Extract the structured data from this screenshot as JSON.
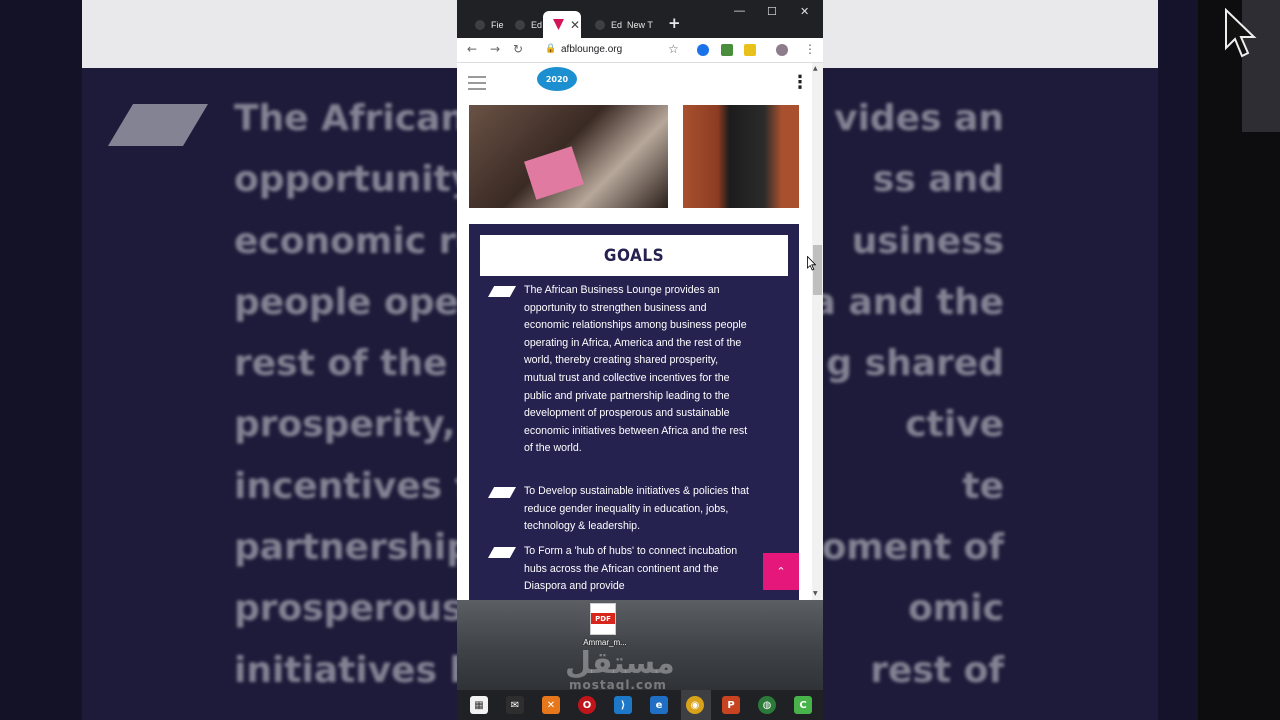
{
  "browser": {
    "tabs": [
      {
        "label": "Fie"
      },
      {
        "label": "Ed"
      },
      {
        "label": ""
      },
      {
        "label": "Ed"
      },
      {
        "label": "New T"
      }
    ],
    "new_tab_symbol": "+",
    "url": "afblounge.org"
  },
  "site": {
    "logo_text": "2020"
  },
  "goals": {
    "title": "GOALS",
    "items": [
      "The African Business Lounge provides an opportunity to strengthen business and economic relationships among business people operating in Africa, America and the rest of the world, thereby creating shared prosperity, mutual trust and collective incentives for the public and private partnership leading to the development of prosperous and sustainable economic initiatives between Africa and the rest of the world.",
      "To Develop sustainable initiatives & policies that reduce gender inequality in education, jobs, technology & leadership.",
      "To Form a 'hub of hubs' to connect incubation hubs across the African continent and the Diaspora and provide"
    ]
  },
  "desktop": {
    "file_label": "Ammar_m...",
    "file_badge": "PDF",
    "watermark": "مستقل",
    "watermark_sub": "mostaql.com"
  },
  "background_zoom": {
    "lines": [
      [
        "The African B",
        "vides an"
      ],
      [
        "opportunity t",
        "ss and"
      ],
      [
        "economic re",
        "usiness"
      ],
      [
        "people opera",
        "ca and the"
      ],
      [
        "rest of the w",
        "g shared"
      ],
      [
        "prosperity, m",
        "ctive"
      ],
      [
        "incentives fo",
        "te"
      ],
      [
        "partnership l",
        "oment of"
      ],
      [
        "prosperous a",
        "omic"
      ],
      [
        "initiatives be",
        "rest of"
      ]
    ]
  },
  "icons": {
    "back": "arrow-left-icon",
    "forward": "arrow-right-icon",
    "reload": "reload-icon",
    "lock": "lock-icon",
    "star": "star-icon"
  },
  "colors": {
    "goals_bg": "#252250",
    "accent_pink": "#e6177b",
    "chrome_dark": "#202124"
  }
}
